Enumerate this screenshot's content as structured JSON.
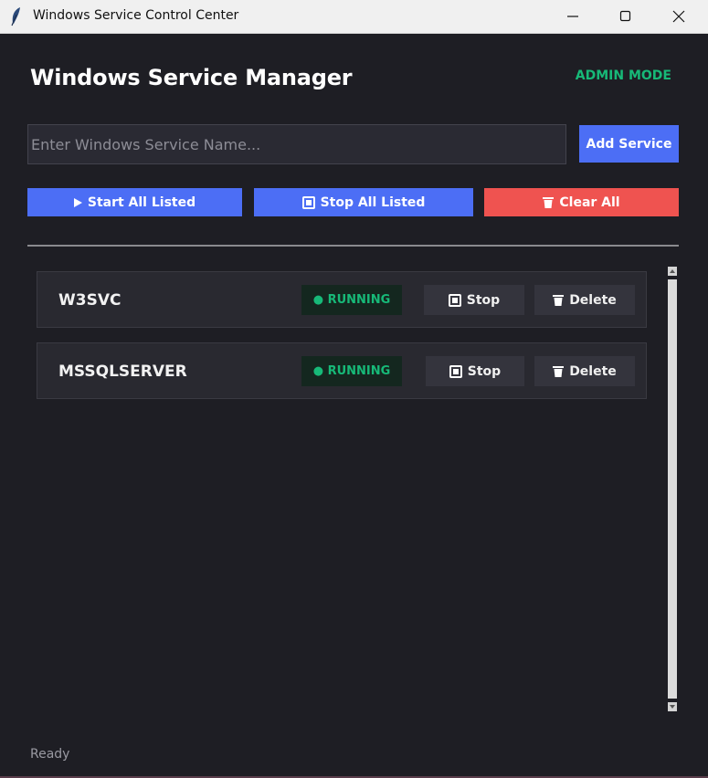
{
  "window": {
    "title": "Windows Service Control Center",
    "icon": "feather-icon",
    "controls": [
      "minimize-icon",
      "maximize-icon",
      "close-icon"
    ]
  },
  "header": {
    "title": "Windows Service Manager",
    "mode": "ADMIN MODE"
  },
  "add_form": {
    "input_value": "",
    "placeholder": "Enter Windows Service Name...",
    "add_label": "Add Service"
  },
  "bulk_actions": {
    "start_label": "Start All Listed",
    "stop_label": "Stop All Listed",
    "clear_label": "Clear All"
  },
  "services": [
    {
      "name": "W3SVC",
      "status": "● RUNNING",
      "stop_label": "Stop",
      "delete_label": "Delete"
    },
    {
      "name": "MSSQLSERVER",
      "status": "● RUNNING",
      "stop_label": "Stop",
      "delete_label": "Delete"
    }
  ],
  "status_bar": {
    "text": "Ready"
  },
  "colors": {
    "background": "#1e1e24",
    "accent": "#4c6ef5",
    "danger": "#ef5350",
    "running": "#17b978",
    "row": "#292930"
  }
}
